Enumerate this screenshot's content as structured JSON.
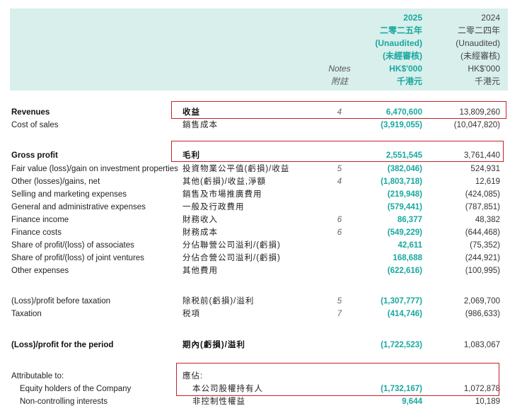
{
  "header": {
    "col2025": {
      "year": "2025",
      "year_zh": "二零二五年",
      "audit": "(Unaudited)",
      "audit_zh": "(未經審核)",
      "currency": "HK$'000",
      "currency_zh": "千港元"
    },
    "col2024": {
      "year": "2024",
      "year_zh": "二零二四年",
      "audit": "(Unaudited)",
      "audit_zh": "(未經審核)",
      "currency": "HK$'000",
      "currency_zh": "千港元"
    },
    "notes": "Notes",
    "notes_zh": "附註"
  },
  "rows": [
    {
      "en": "Revenues",
      "zh": "收益",
      "note": "4",
      "v2025": "6,470,600",
      "v2024": "13,809,260"
    },
    {
      "en": "Cost of sales",
      "zh": "銷售成本",
      "note": "",
      "v2025": "(3,919,055)",
      "v2024": "(10,047,820)"
    },
    {
      "en": "Gross profit",
      "zh": "毛利",
      "note": "",
      "v2025": "2,551,545",
      "v2024": "3,761,440"
    },
    {
      "en": "Fair value (loss)/gain on investment properties",
      "zh": "投資物業公平值(虧損)/收益",
      "note": "5",
      "v2025": "(382,046)",
      "v2024": "524,931"
    },
    {
      "en": "Other (losses)/gains, net",
      "zh": "其他(虧損)/收益,淨額",
      "note": "4",
      "v2025": "(1,803,718)",
      "v2024": "12,619"
    },
    {
      "en": "Selling and marketing expenses",
      "zh": "銷售及市場推廣費用",
      "note": "",
      "v2025": "(219,948)",
      "v2024": "(424,085)"
    },
    {
      "en": "General and administrative expenses",
      "zh": "一般及行政費用",
      "note": "",
      "v2025": "(579,441)",
      "v2024": "(787,851)"
    },
    {
      "en": "Finance income",
      "zh": "財務收入",
      "note": "6",
      "v2025": "86,377",
      "v2024": "48,382"
    },
    {
      "en": "Finance costs",
      "zh": "財務成本",
      "note": "6",
      "v2025": "(549,229)",
      "v2024": "(644,468)"
    },
    {
      "en": "Share of profit/(loss) of associates",
      "zh": "分佔聯營公司溢利/(虧損)",
      "note": "",
      "v2025": "42,611",
      "v2024": "(75,352)"
    },
    {
      "en": "Share of profit/(loss) of joint ventures",
      "zh": "分佔合營公司溢利/(虧損)",
      "note": "",
      "v2025": "168,688",
      "v2024": "(244,921)"
    },
    {
      "en": "Other expenses",
      "zh": "其他費用",
      "note": "",
      "v2025": "(622,616)",
      "v2024": "(100,995)"
    },
    {
      "en": "(Loss)/profit before taxation",
      "zh": "除税前(虧損)/溢利",
      "note": "5",
      "v2025": "(1,307,777)",
      "v2024": "2,069,700"
    },
    {
      "en": "Taxation",
      "zh": "税項",
      "note": "7",
      "v2025": "(414,746)",
      "v2024": "(986,633)"
    },
    {
      "en": "(Loss)/profit for the period",
      "zh": "期內(虧損)/溢利",
      "note": "",
      "v2025": "(1,722,523)",
      "v2024": "1,083,067"
    },
    {
      "en": "Attributable to:",
      "zh": "應佔:",
      "note": "",
      "v2025": "",
      "v2024": ""
    },
    {
      "en": "Equity holders of the Company",
      "zh": "本公司股權持有人",
      "note": "",
      "v2025": "(1,732,167)",
      "v2024": "1,072,878"
    },
    {
      "en": "Non-controlling interests",
      "zh": "非控制性權益",
      "note": "",
      "v2025": "9,644",
      "v2024": "10,189"
    }
  ]
}
